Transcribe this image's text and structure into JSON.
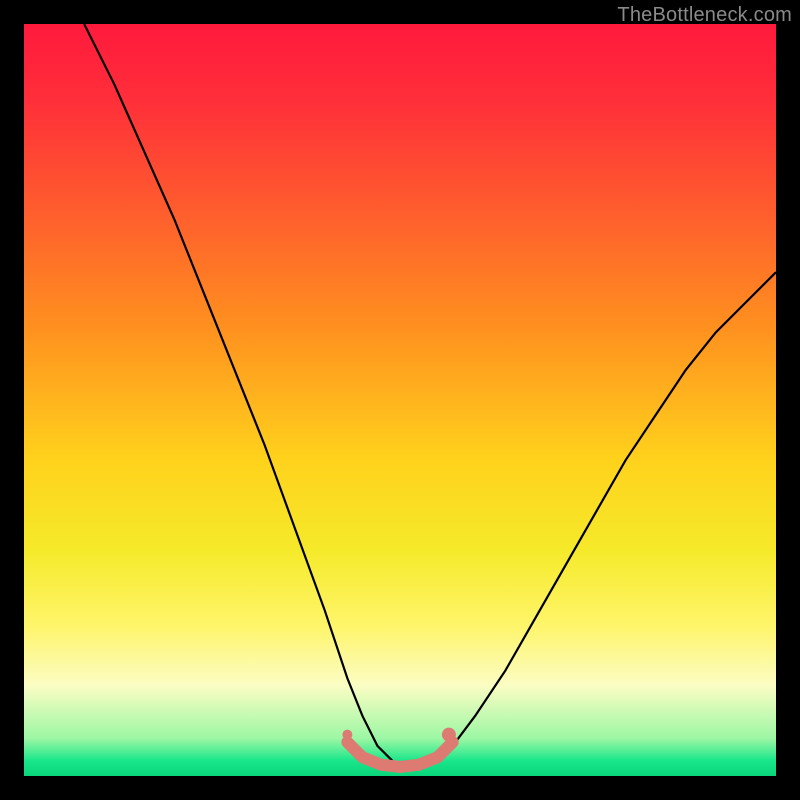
{
  "watermark_text": "TheBottleneck.com",
  "chart_data": {
    "type": "line",
    "title": "",
    "xlabel": "",
    "ylabel": "",
    "xlim": [
      0,
      100
    ],
    "ylim": [
      0,
      100
    ],
    "grid": false,
    "series": [
      {
        "name": "bottleneck-curve",
        "color": "#000000",
        "x": [
          8,
          12,
          16,
          20,
          24,
          28,
          32,
          36,
          40,
          43,
          45,
          47,
          49,
          51,
          53,
          55,
          57,
          60,
          64,
          68,
          72,
          76,
          80,
          84,
          88,
          92,
          96,
          100
        ],
        "y": [
          100,
          92,
          83,
          74,
          64,
          54,
          44,
          33,
          22,
          13,
          8,
          4,
          2,
          1,
          1,
          2,
          4,
          8,
          14,
          21,
          28,
          35,
          42,
          48,
          54,
          59,
          63,
          67
        ]
      },
      {
        "name": "ideal-flat-segment",
        "color": "#dd7b73",
        "x": [
          43,
          45,
          47.5,
          50,
          52.5,
          55,
          57
        ],
        "y": [
          4.5,
          2.5,
          1.5,
          1.2,
          1.5,
          2.5,
          4.5
        ]
      }
    ],
    "markers": [
      {
        "name": "left-dot",
        "x": 43,
        "y": 5.5,
        "color": "#dd7b73",
        "r": 5
      },
      {
        "name": "right-dot",
        "x": 56.5,
        "y": 5.5,
        "color": "#dd7b73",
        "r": 7
      }
    ],
    "background_gradient": {
      "top": "#ff1a3c",
      "mid": "#f5ea2a",
      "bottom": "#0ad67c"
    }
  }
}
